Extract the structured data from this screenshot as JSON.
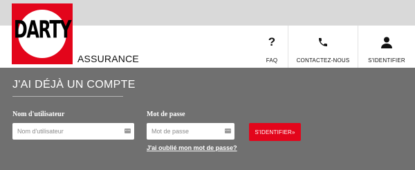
{
  "brand": {
    "logo_text": "DARTY",
    "section_name": "ASSURANCE",
    "colors": {
      "brand_red": "#e3051b",
      "panel_gray": "#707070",
      "header_bg": "#ffffff",
      "top_strip": "#d9d9d9"
    }
  },
  "nav": {
    "items": [
      {
        "label": "FAQ",
        "icon": "question-icon"
      },
      {
        "label": "CONTACTEZ-NOUS",
        "icon": "phone-icon"
      },
      {
        "label": "S'IDENTIFIER",
        "icon": "user-icon"
      }
    ]
  },
  "login": {
    "title": "J'AI DÉJÀ UN COMPTE",
    "username_label": "Nom d'utilisateur",
    "username_placeholder": "Nom d'utilisateur",
    "username_value": "",
    "password_label": "Mot de passe",
    "password_placeholder": "Mot de passe",
    "password_value": "",
    "submit_label": "S'IDENTIFIER»",
    "forgot_label": "J'ai oublié mon mot de passe?"
  }
}
